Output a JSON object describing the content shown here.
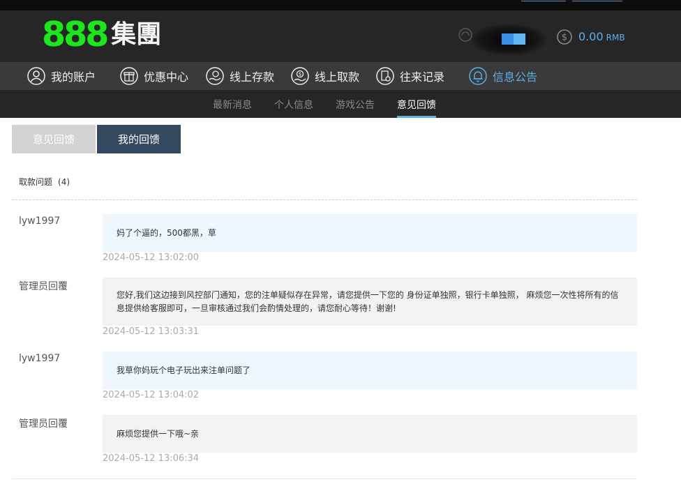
{
  "header": {
    "logo_number": "888",
    "logo_text": "集團",
    "balance": {
      "amount": "0.00",
      "currency": "RMB"
    },
    "colors": {
      "brand_green": "#1ee61e",
      "accent_blue": "#5aafe8",
      "header_bg": "#262626",
      "nav_bg": "#3a3a3a"
    }
  },
  "main_nav": {
    "items": [
      {
        "label": "我的账户",
        "icon": "user-icon"
      },
      {
        "label": "优惠中心",
        "icon": "gift-icon"
      },
      {
        "label": "线上存款",
        "icon": "deposit-icon"
      },
      {
        "label": "线上取款",
        "icon": "withdraw-icon"
      },
      {
        "label": "往来记录",
        "icon": "record-icon"
      },
      {
        "label": "信息公告",
        "icon": "bell-icon",
        "active": true
      }
    ]
  },
  "sub_nav": {
    "items": [
      {
        "label": "最新消息"
      },
      {
        "label": "个人信息"
      },
      {
        "label": "游戏公告"
      },
      {
        "label": "意见回馈",
        "active": true
      }
    ]
  },
  "tabs": {
    "feedback": "意见回馈",
    "my_feedback": "我的回馈"
  },
  "thread": {
    "topic": "取款问题",
    "count": "(4)",
    "messages": [
      {
        "author": "lyw1997",
        "role": "user",
        "text": "妈了个逼的，500都黑，草",
        "time": "2024-05-12 13:02:00"
      },
      {
        "author": "管理员回覆",
        "role": "admin",
        "text": "您好,我们这边接到风控部门通知，您的注单疑似存在异常，请您提供一下您的 身份证单独照，银行卡单独照， 麻烦您一次性将所有的信息提供给客服即可，一旦审核通过我们会酌情处理的，请您耐心等待！谢谢!",
        "time": "2024-05-12 13:03:31"
      },
      {
        "author": "lyw1997",
        "role": "user",
        "text": "我草你妈玩个电子玩出来注单问题了",
        "time": "2024-05-12 13:04:02"
      },
      {
        "author": "管理员回覆",
        "role": "admin",
        "text": "麻烦您提供一下哦~亲",
        "time": "2024-05-12 13:06:34"
      }
    ]
  }
}
